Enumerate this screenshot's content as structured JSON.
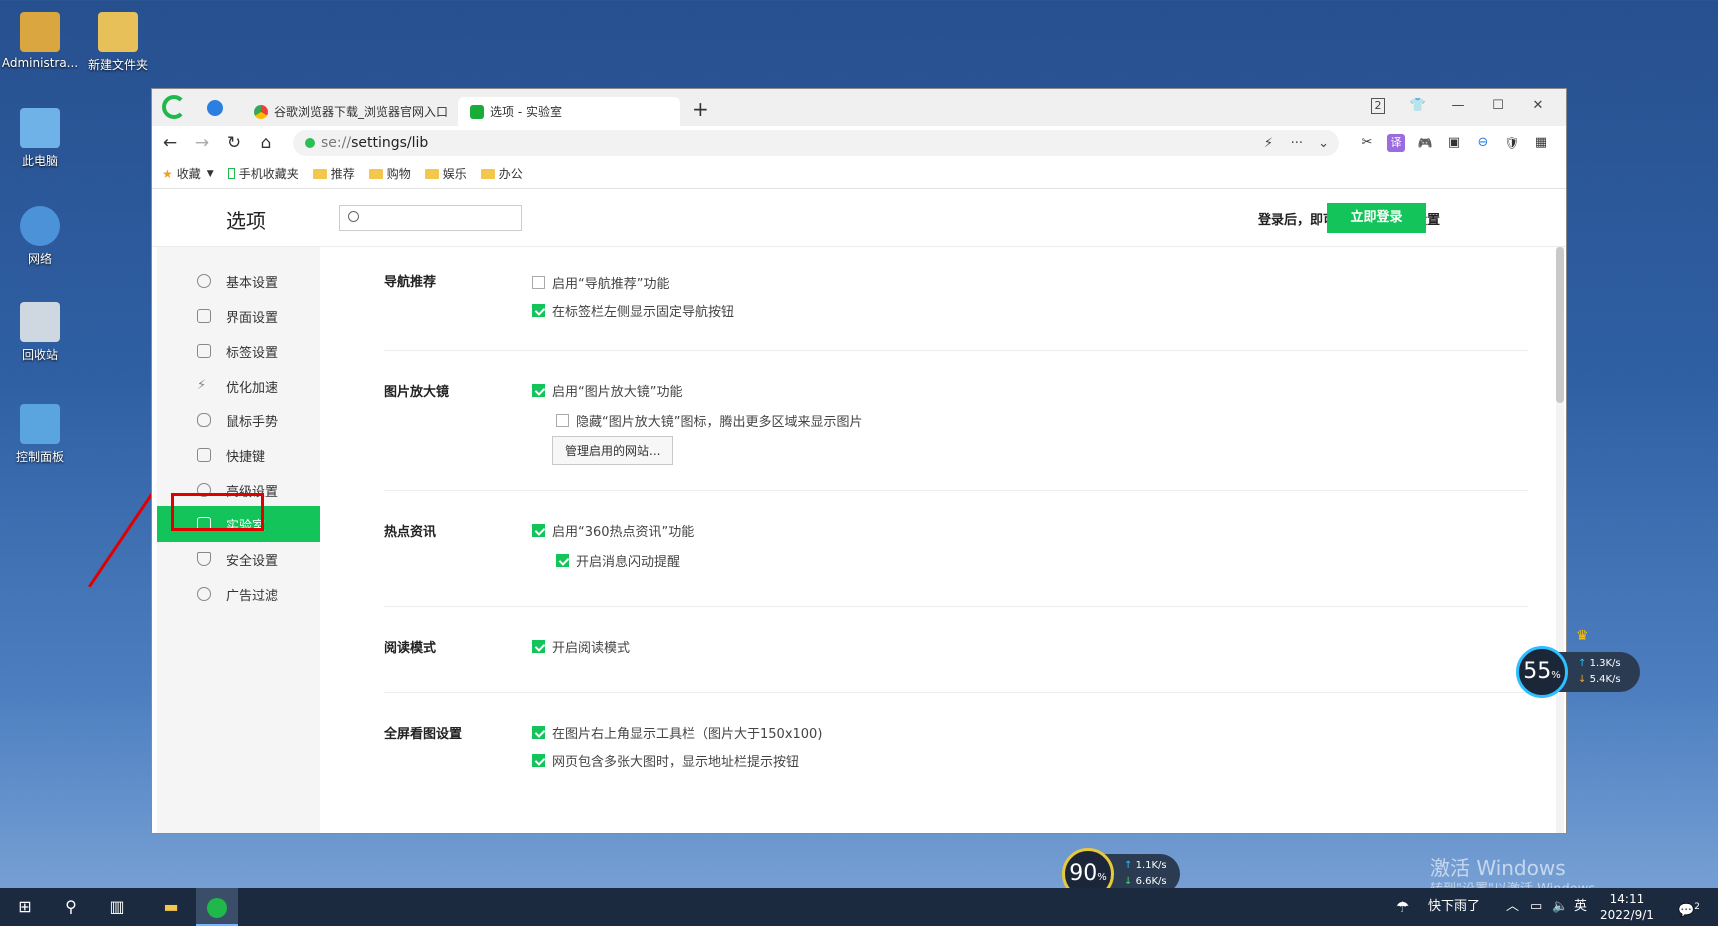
{
  "desktop": {
    "icons": [
      {
        "label": "Administra...",
        "color": "#d9a640"
      },
      {
        "label": "新建文件夹",
        "color": "#e8c05a"
      },
      {
        "label": "此电脑",
        "color": "#6fb2e8"
      },
      {
        "label": "网络",
        "color": "#4c92d8"
      },
      {
        "label": "回收站",
        "color": "#cfd8e0"
      },
      {
        "label": "控制面板",
        "color": "#5aa5e0"
      }
    ]
  },
  "browser": {
    "tabs": [
      {
        "title": "谷歌浏览器下载_浏览器官网入口"
      },
      {
        "title": "选项 - 实验室"
      }
    ],
    "new_tab": "+",
    "window_buttons": {
      "badge": "2",
      "min": "—",
      "max": "☐",
      "close": "✕"
    },
    "nav": {
      "back": "←",
      "forward": "→",
      "reload": "↻",
      "home": "⌂"
    },
    "address": {
      "scheme": "se://",
      "path": "settings/lib"
    },
    "addr_icons": {
      "lightning": "⚡",
      "more": "···",
      "down": "⌄"
    },
    "toolbar_icons": [
      "✂",
      "译",
      "🎮",
      "▣",
      "⊖",
      "🛡",
      "▦",
      "⤓",
      "↶",
      "≡"
    ],
    "bookmarks": [
      "收藏",
      "手机收藏夹",
      "推荐",
      "购物",
      "娱乐",
      "办公"
    ]
  },
  "settings": {
    "title": "选项",
    "search_placeholder": "",
    "login_tip": "登录后，即可多端同步你的设置",
    "login_button": "立即登录",
    "sidebar": [
      "基本设置",
      "界面设置",
      "标签设置",
      "优化加速",
      "鼠标手势",
      "快捷键",
      "高级设置",
      "实验室",
      "安全设置",
      "广告过滤"
    ],
    "active_item": "实验室",
    "sections": [
      {
        "title": "导航推荐",
        "options": [
          {
            "label": "启用“导航推荐”功能",
            "checked": false
          },
          {
            "label": "在标签栏左侧显示固定导航按钮",
            "checked": true
          }
        ]
      },
      {
        "title": "图片放大镜",
        "options": [
          {
            "label": "启用“图片放大镜”功能",
            "checked": true
          },
          {
            "label": "隐藏“图片放大镜”图标，腾出更多区域来显示图片",
            "checked": false
          }
        ],
        "button": "管理启用的网站..."
      },
      {
        "title": "热点资讯",
        "options": [
          {
            "label": "启用“360热点资讯”功能",
            "checked": true
          },
          {
            "label": "开启消息闪动提醒",
            "checked": true
          }
        ]
      },
      {
        "title": "阅读模式",
        "options": [
          {
            "label": "开启阅读模式",
            "checked": true
          }
        ]
      },
      {
        "title": "全屏看图设置",
        "options": [
          {
            "label": "在图片右上角显示工具栏（图片大于150x100)",
            "checked": true
          },
          {
            "label": "网页包含多张大图时，显示地址栏提示按钮",
            "checked": true
          }
        ]
      }
    ]
  },
  "widgets": {
    "speed1": {
      "percent": "55",
      "up": "1.3K/s",
      "down": "5.4K/s"
    },
    "speed2": {
      "percent": "90",
      "up": "1.1K/s",
      "down": "6.6K/s"
    }
  },
  "watermark": {
    "line1": "激活 Windows",
    "line2": "转到\"设置\"以激活 Windows。"
  },
  "taskbar": {
    "weather": "快下雨了",
    "ime": "英",
    "time": "14:11",
    "date": "2022/9/1",
    "notify": "2"
  }
}
